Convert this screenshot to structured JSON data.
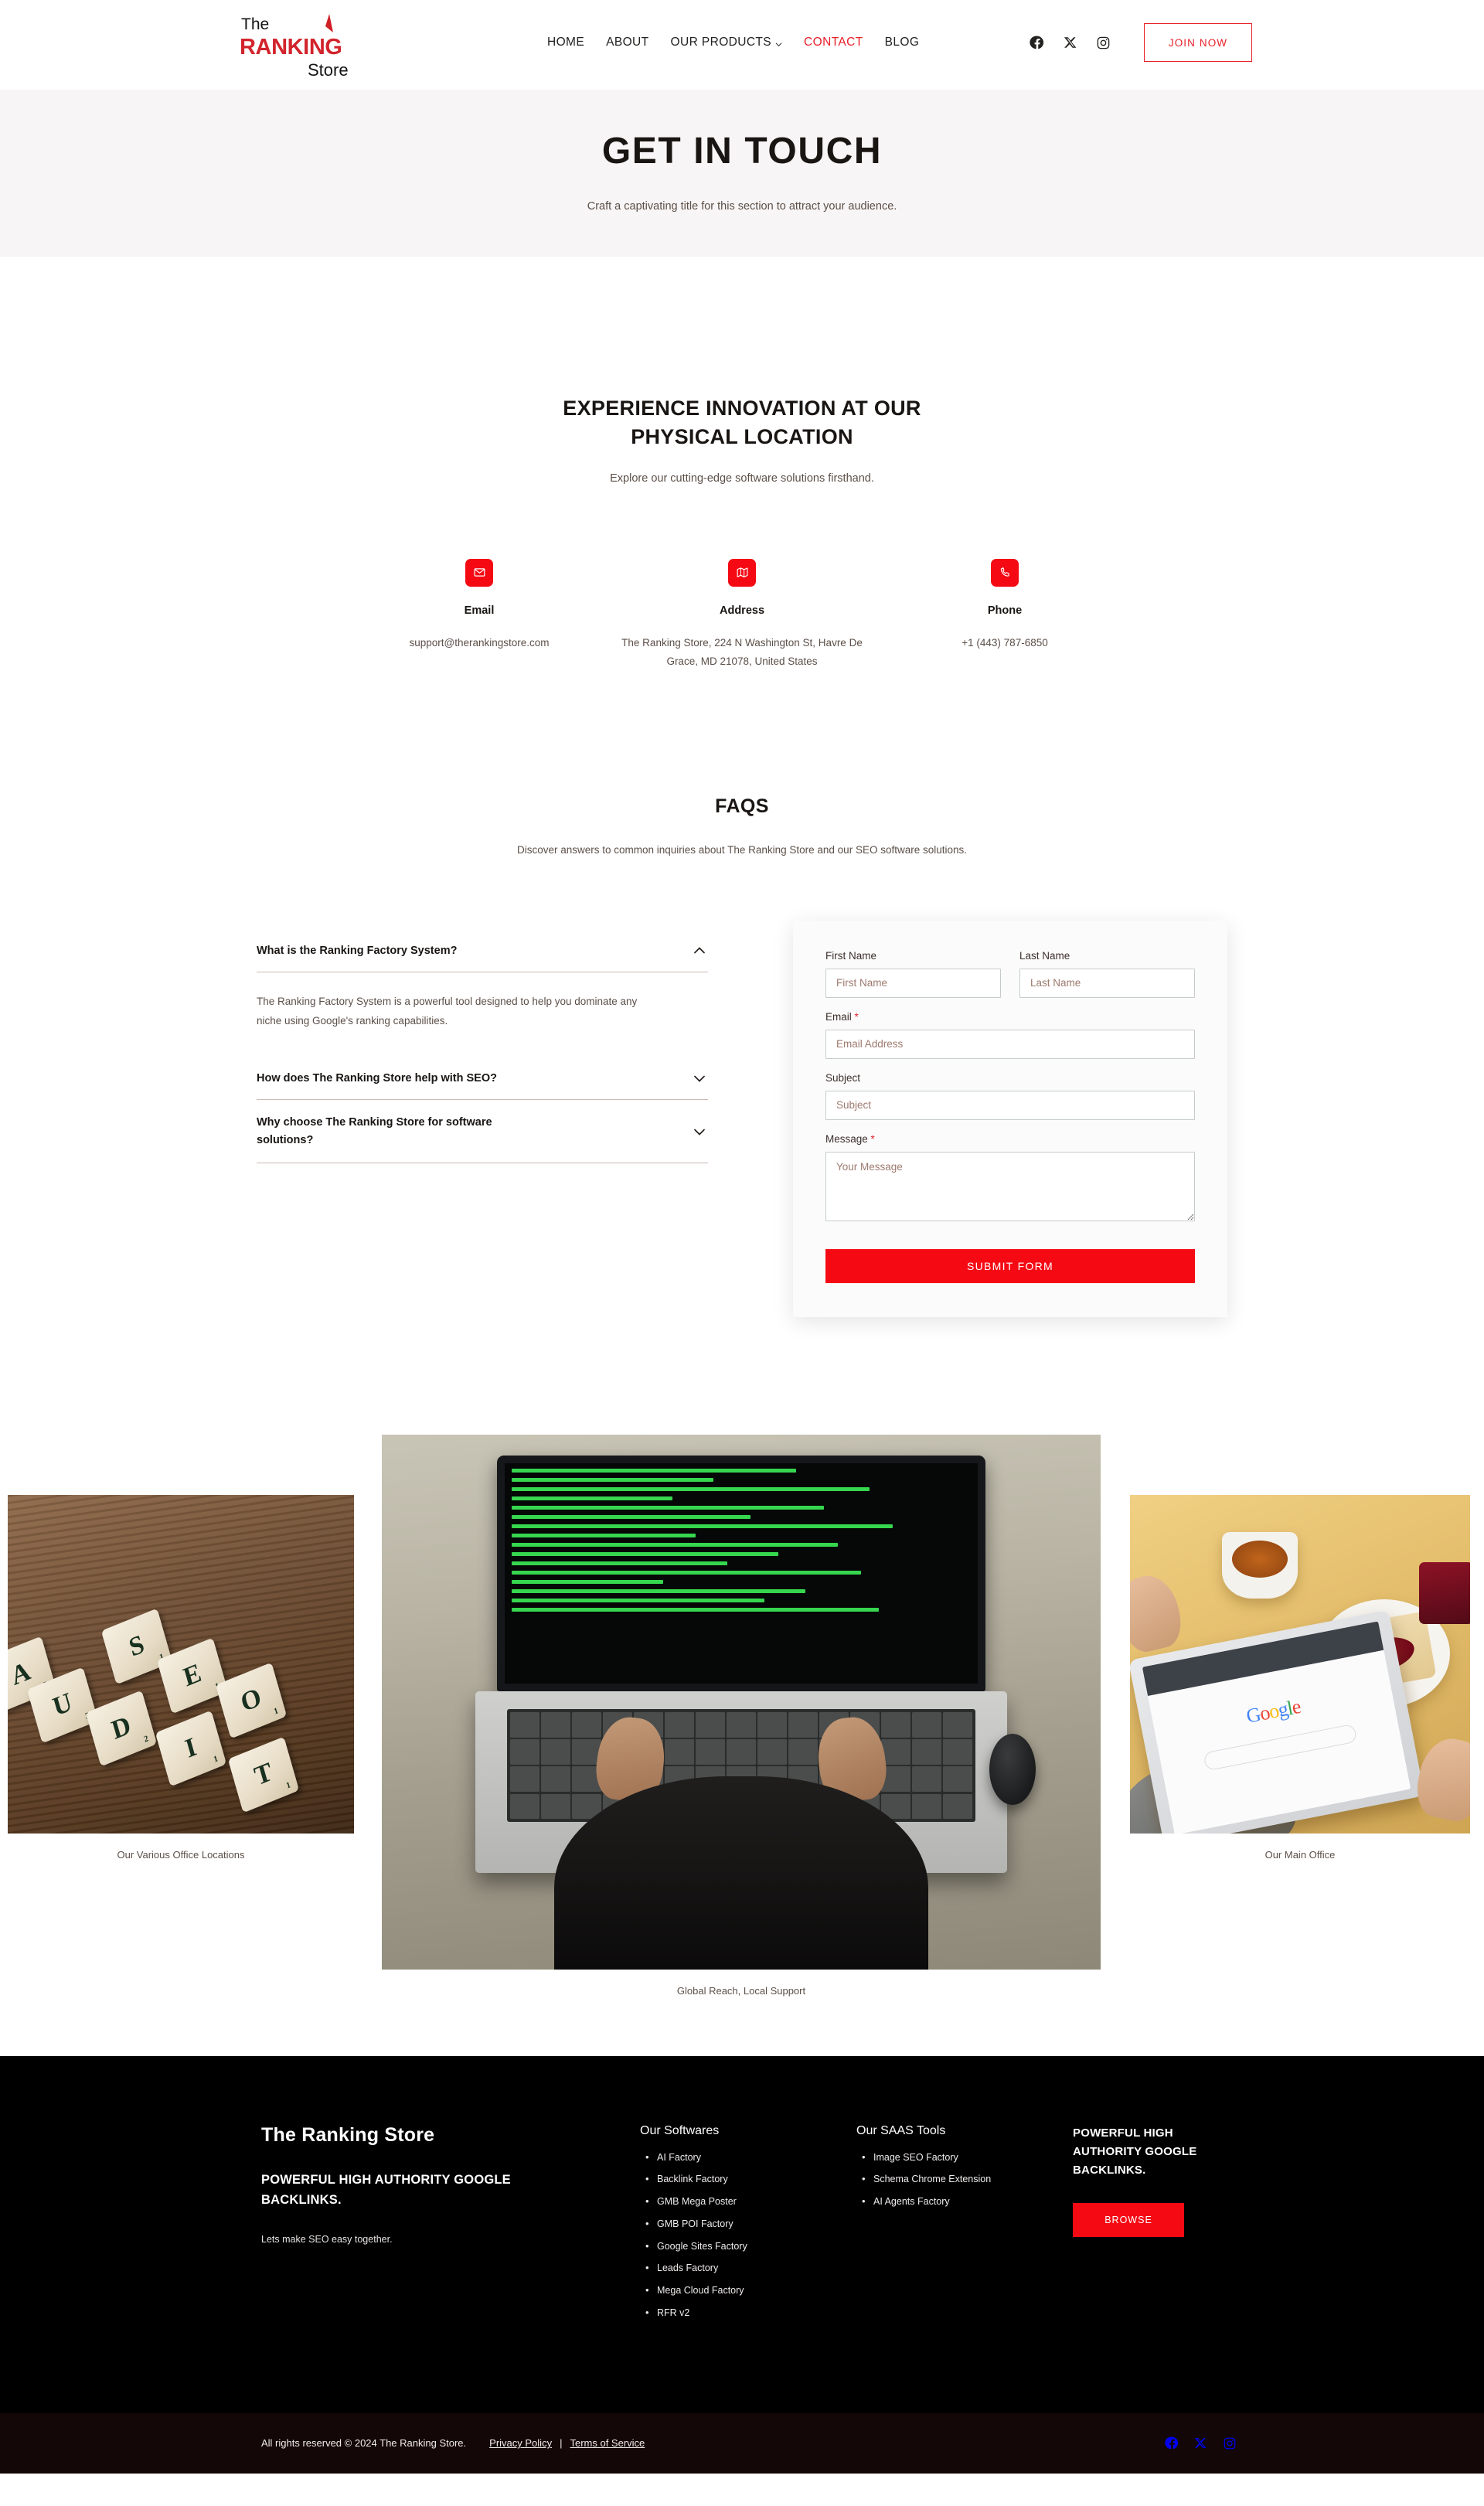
{
  "header": {
    "logo": {
      "line1": "The",
      "line2": "RANKING",
      "line3": "Store"
    },
    "nav": [
      {
        "label": "HOME",
        "accent": false,
        "dropdown": false
      },
      {
        "label": "ABOUT",
        "accent": false,
        "dropdown": false
      },
      {
        "label": "OUR PRODUCTS",
        "accent": false,
        "dropdown": true
      },
      {
        "label": "CONTACT",
        "accent": true,
        "dropdown": false
      },
      {
        "label": "BLOG",
        "accent": false,
        "dropdown": false
      }
    ],
    "socials": [
      "facebook-icon",
      "x-icon",
      "instagram-icon"
    ],
    "cta_label": "JOIN NOW"
  },
  "hero": {
    "title": "GET IN TOUCH",
    "subtitle": "Craft a captivating title for this section to attract your audience."
  },
  "innovation": {
    "title": "EXPERIENCE INNOVATION AT OUR PHYSICAL LOCATION",
    "subtitle": "Explore our cutting-edge software solutions firsthand.",
    "contacts": [
      {
        "icon": "envelope-icon",
        "label": "Email",
        "value": "support@therankingstore.com"
      },
      {
        "icon": "map-icon",
        "label": "Address",
        "value": "The Ranking Store, 224 N Washington St, Havre De Grace, MD 21078, United States"
      },
      {
        "icon": "phone-icon",
        "label": "Phone",
        "value": "+1 (443) 787-6850"
      }
    ]
  },
  "faq": {
    "title": "FAQS",
    "subtitle": "Discover answers to common inquiries about The Ranking Store and our SEO software solutions.",
    "items": [
      {
        "question": "What is the Ranking Factory System?",
        "answer": "The Ranking Factory System is a powerful tool designed to help you dominate any niche using Google's ranking capabilities.",
        "expanded": true
      },
      {
        "question": "How does The Ranking Store help with SEO?",
        "answer": "",
        "expanded": false
      },
      {
        "question": "Why choose The Ranking Store for software solutions?",
        "answer": "",
        "expanded": false
      }
    ]
  },
  "form": {
    "first_name": {
      "label": "First Name",
      "placeholder": "First Name",
      "value": "",
      "required": false
    },
    "last_name": {
      "label": "Last Name",
      "placeholder": "Last Name",
      "value": "",
      "required": false
    },
    "email": {
      "label": "Email",
      "placeholder": "Email Address",
      "value": "",
      "required": true
    },
    "subject": {
      "label": "Subject",
      "placeholder": "Subject",
      "value": "",
      "required": false
    },
    "message": {
      "label": "Message",
      "placeholder": "Your Message",
      "value": "",
      "required": true
    },
    "submit_label": "SUBMIT FORM",
    "required_marker": "*"
  },
  "gallery": [
    {
      "caption": "Our Various Office Locations",
      "alt": "seo-audit-scrabble-tiles"
    },
    {
      "caption": "Global Reach, Local Support",
      "alt": "laptop-with-code-typing"
    },
    {
      "caption": "Our Main Office",
      "alt": "tablet-google-search-breakfast"
    }
  ],
  "footer": {
    "brand": "The Ranking Store",
    "tagline": "POWERFUL HIGH AUTHORITY GOOGLE BACKLINKS.",
    "small": "Lets make SEO easy together.",
    "softwares": {
      "heading": "Our Softwares",
      "items": [
        "AI Factory",
        "Backlink Factory",
        "GMB Mega Poster",
        "GMB POI Factory",
        "Google Sites Factory",
        "Leads Factory",
        "Mega Cloud Factory",
        "RFR v2"
      ]
    },
    "saas": {
      "heading": "Our SAAS Tools",
      "items": [
        "Image SEO Factory",
        "Schema Chrome Extension",
        "AI Agents Factory"
      ]
    },
    "cta": {
      "title": "POWERFUL HIGH AUTHORITY GOOGLE BACKLINKS.",
      "button": "BROWSE"
    },
    "bar": {
      "copyright": "All rights reserved © 2024 The Ranking Store.",
      "privacy": "Privacy Policy",
      "divider": "|",
      "terms": "Terms of Service",
      "socials": [
        "facebook-icon",
        "x-icon",
        "instagram-icon"
      ]
    }
  },
  "colors": {
    "accent": "#f50a14",
    "accent_alt": "#e8202a",
    "hero_bg": "#f7f5f5",
    "footer_bg": "#000000",
    "footer_bar_bg": "#130707"
  }
}
